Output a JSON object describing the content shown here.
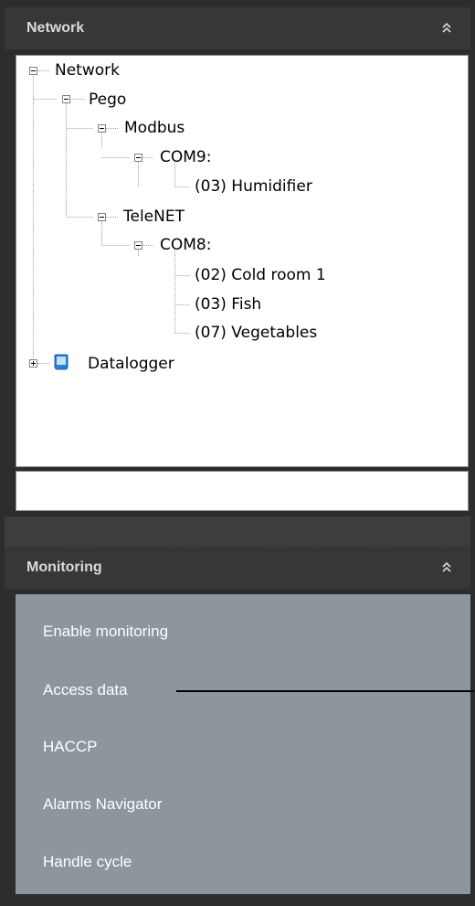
{
  "network": {
    "title": "Network",
    "collapse_icon": "double-chevron-up-icon",
    "tree": {
      "root": "Network",
      "pego": "Pego",
      "modbus": "Modbus",
      "com9": "COM9:",
      "humidifier": "(03) Humidifier",
      "telenet": "TeleNET",
      "com8": "COM8:",
      "cold_room": "(02) Cold room 1",
      "fish": "(03) Fish",
      "vegetables": "(07) Vegetables",
      "datalogger": "Datalogger"
    }
  },
  "monitoring": {
    "title": "Monitoring",
    "collapse_icon": "double-chevron-up-icon",
    "items": [
      "Enable monitoring",
      "Access data",
      "HACCP",
      "Alarms Navigator",
      "Handle cycle"
    ]
  },
  "colors": {
    "background": "#2d2d2d",
    "header": "#373737",
    "menu_panel": "#8c969c",
    "tree_bg": "#ffffff",
    "datalogger_icon": "#2a7fd4"
  }
}
